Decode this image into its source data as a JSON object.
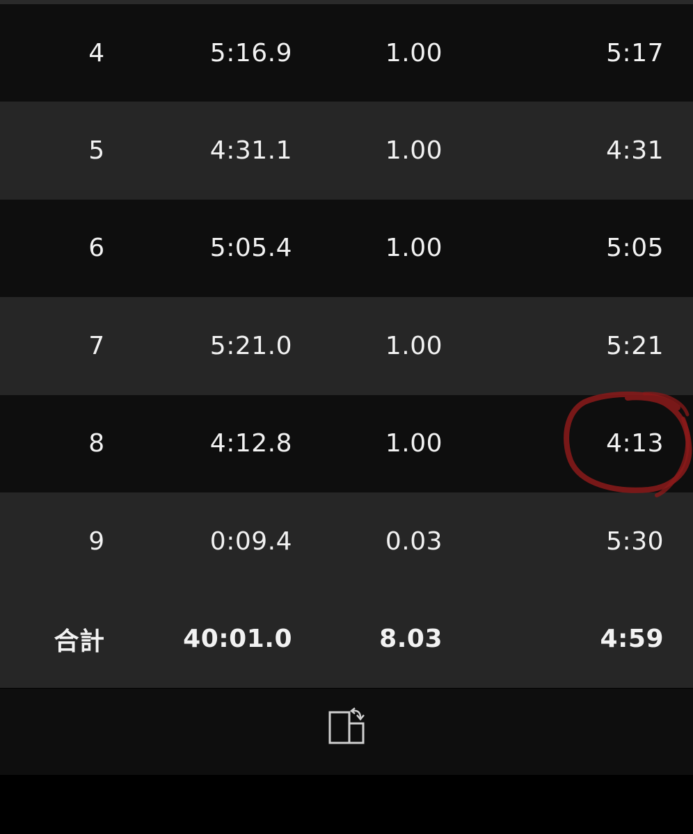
{
  "laps": [
    {
      "lap": "4",
      "time": "5:16.9",
      "distance": "1.00",
      "pace": "5:17"
    },
    {
      "lap": "5",
      "time": "4:31.1",
      "distance": "1.00",
      "pace": "4:31"
    },
    {
      "lap": "6",
      "time": "5:05.4",
      "distance": "1.00",
      "pace": "5:05"
    },
    {
      "lap": "7",
      "time": "5:21.0",
      "distance": "1.00",
      "pace": "5:21"
    },
    {
      "lap": "8",
      "time": "4:12.8",
      "distance": "1.00",
      "pace": "4:13"
    },
    {
      "lap": "9",
      "time": "0:09.4",
      "distance": "0.03",
      "pace": "5:30"
    }
  ],
  "total": {
    "lap": "合計",
    "time": "40:01.0",
    "distance": "8.03",
    "pace": "4:59"
  },
  "footer": {
    "icon": "rotate-screen-icon"
  },
  "colors": {
    "row_dark": "#0e0e0e",
    "row_light": "#262626",
    "text": "#f2f2f2",
    "annotation": "#8b1a1a"
  }
}
